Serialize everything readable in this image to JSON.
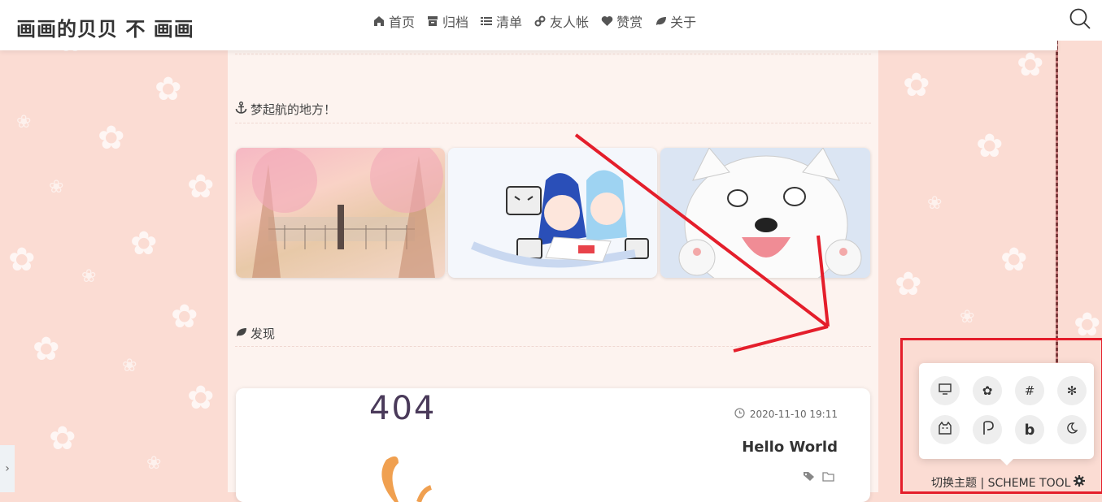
{
  "header": {
    "logo": "画画的贝贝 不 画画",
    "nav": [
      {
        "label": "首页",
        "icon": "home-icon"
      },
      {
        "label": "归档",
        "icon": "archive-icon"
      },
      {
        "label": "清单",
        "icon": "list-icon"
      },
      {
        "label": "友人帐",
        "icon": "link-icon"
      },
      {
        "label": "赞赏",
        "icon": "heart-icon"
      },
      {
        "label": "关于",
        "icon": "leaf-icon"
      }
    ],
    "search_icon": "search-icon"
  },
  "main": {
    "section1_title": "梦起航的地方！",
    "section2_title": "发现",
    "post": {
      "image_text": "404",
      "date": "2020-11-10 19:11",
      "title": "Hello World"
    }
  },
  "theme_tool": {
    "label": "切换主题 | SCHEME TOOL",
    "buttons": [
      "monitor-icon",
      "sakura-icon",
      "hash-icon",
      "snowflake-icon",
      "cat-icon",
      "pixiv-icon",
      "bing-icon",
      "moon-icon"
    ]
  },
  "colors": {
    "background": "#fbdcd3",
    "annotation_red": "#e41e2b"
  }
}
